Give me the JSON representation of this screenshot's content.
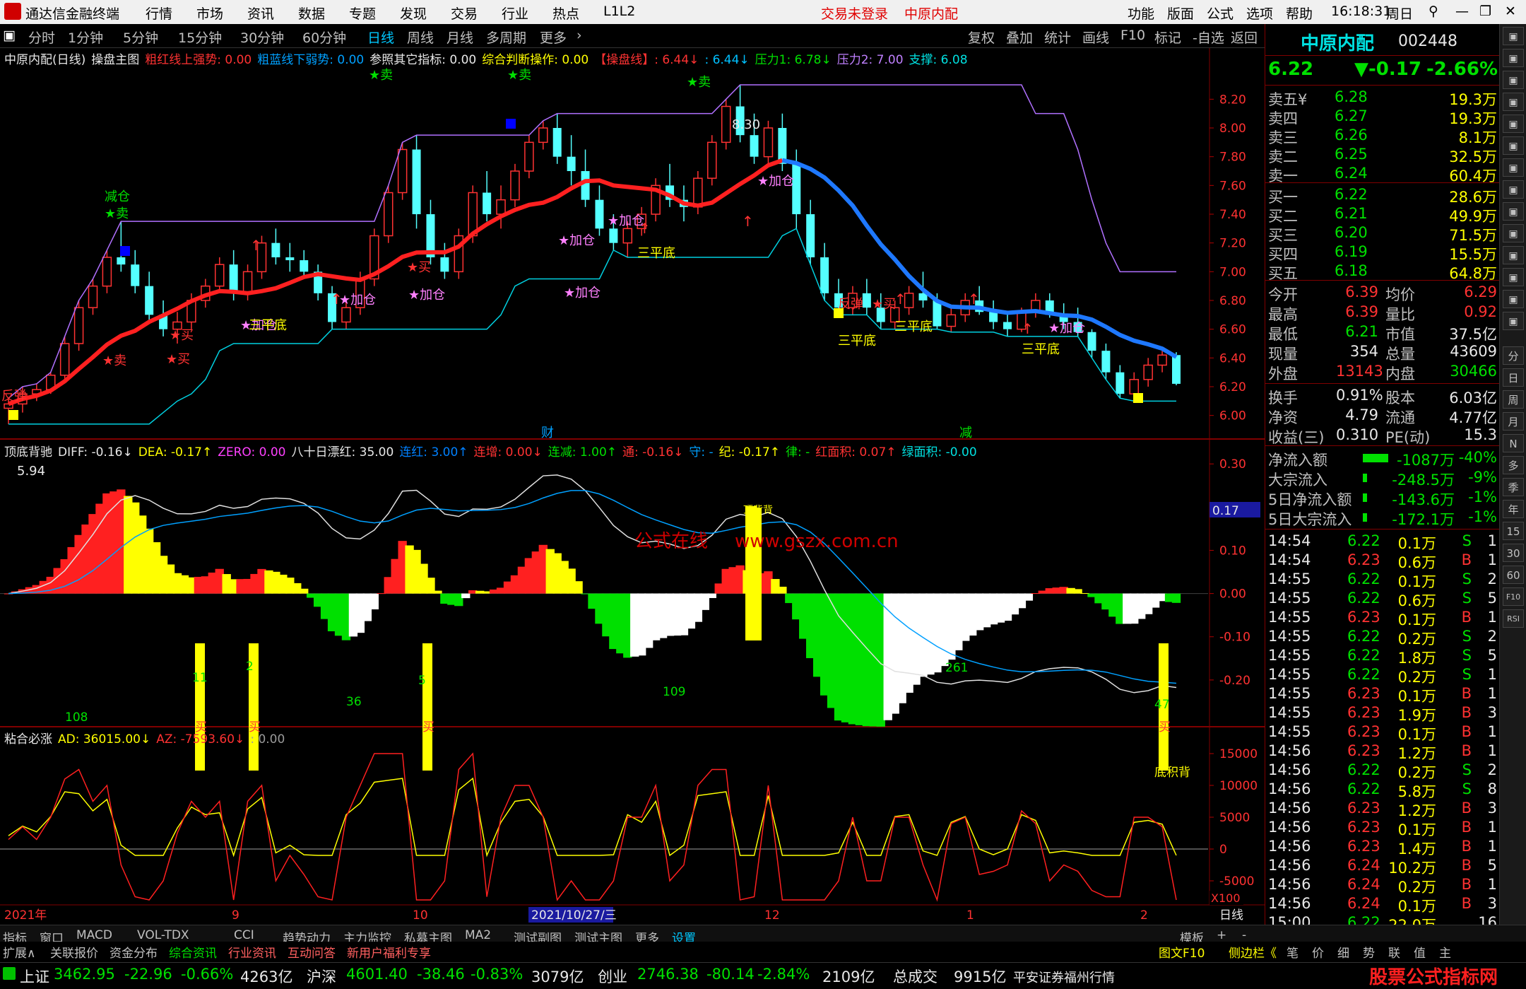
{
  "menubar": {
    "app_name": "通达信金融终端",
    "items": [
      "行情",
      "市场",
      "资讯",
      "数据",
      "专题",
      "发现",
      "交易",
      "行业",
      "热点",
      "L1L2"
    ],
    "login": "交易未登录",
    "stock": "中原内配",
    "right_items": [
      "功能",
      "版面",
      "公式",
      "选项",
      "帮助"
    ],
    "time": "16:18:31",
    "day": "周日"
  },
  "toolbar": {
    "periods": [
      "分时",
      "1分钟",
      "5分钟",
      "15分钟",
      "30分钟",
      "60分钟",
      "日线",
      "周线",
      "月线",
      "多周期",
      "更多"
    ],
    "active": "日线",
    "actions": [
      "复权",
      "叠加",
      "统计",
      "画线",
      "F10",
      "标记",
      "-自选",
      "返回"
    ]
  },
  "main_legend": {
    "title": "中原内配(日线)",
    "formula": "操盘主图",
    "items": [
      {
        "t": "粗红线上强势: 0.00",
        "c": "#ff3232"
      },
      {
        "t": "粗蓝线下弱势: 0.00",
        "c": "#00a0ff"
      },
      {
        "t": "参照其它指标: 0.00",
        "c": "#e8e8e8"
      },
      {
        "t": "综合判断操作: 0.00",
        "c": "#ffff00"
      },
      {
        "t": "【操盘线】: 6.44↓",
        "c": "#ff3232"
      },
      {
        "t": ": 6.44↓",
        "c": "#00c0ff"
      },
      {
        "t": "压力1: 6.78↓",
        "c": "#00e000"
      },
      {
        "t": "压力2: 7.00",
        "c": "#c080ff"
      },
      {
        "t": "支撑: 6.08",
        "c": "#00e0e0"
      }
    ]
  },
  "price_axis": [
    "8.20",
    "8.00",
    "7.80",
    "7.60",
    "7.40",
    "7.20",
    "7.00",
    "6.80",
    "6.60",
    "6.40",
    "6.20",
    "6.00"
  ],
  "main_annotations": {
    "high": "8.30",
    "low": "5.94",
    "labels": [
      "★卖",
      "★卖",
      "★卖",
      "★卖",
      "减仓",
      "★卖",
      "★买",
      "反弹",
      "★买",
      "★加仓",
      "★加仓",
      "★加仓",
      "★加仓",
      "★加仓",
      "★加仓",
      "★加仓",
      "★加仓",
      "三平底",
      "三平底",
      "三平底",
      "三平底",
      "三平底",
      "★买",
      "★买",
      "反弹"
    ],
    "event_cai": "财",
    "event_jian": "减"
  },
  "macd_legend": {
    "title": "顶底背驰",
    "items": [
      {
        "t": "DIFF: -0.16↓",
        "c": "#e8e8e8"
      },
      {
        "t": "DEA: -0.17↑",
        "c": "#ffff00"
      },
      {
        "t": "ZERO: 0.00",
        "c": "#ff40ff"
      },
      {
        "t": "八十日漂红: 35.00",
        "c": "#e8e8e8"
      },
      {
        "t": "连红: 3.00↑",
        "c": "#0080ff"
      },
      {
        "t": "连增: 0.00↓",
        "c": "#ff3232"
      },
      {
        "t": "连减: 1.00↑",
        "c": "#00e000"
      },
      {
        "t": "通: -0.16↓",
        "c": "#ff3232"
      },
      {
        "t": "守: -",
        "c": "#00a0ff"
      },
      {
        "t": "纪: -0.17↑",
        "c": "#ffff00"
      },
      {
        "t": "律: -",
        "c": "#00e000"
      },
      {
        "t": "红面积: 0.07↑",
        "c": "#ff3232"
      },
      {
        "t": "绿面积: -0.00",
        "c": "#00e0e0"
      }
    ]
  },
  "macd_axis": [
    "0.30",
    "0.20",
    "0.10",
    "0.00",
    "-0.10",
    "-0.20"
  ],
  "macd_current": "0.17",
  "watermark": {
    "cn": "公式在线",
    "url": "www.gszx.com.cn"
  },
  "macd_labels": {
    "counts": [
      "108",
      "36",
      "109",
      "261",
      "11",
      "2",
      "5",
      "47"
    ],
    "buy": "买",
    "sell_top": "顶背背",
    "bottom": "底积背"
  },
  "ad_legend": {
    "title": "粘合必涨",
    "items": [
      {
        "t": "AD: 36015.00↓",
        "c": "#ffff00"
      },
      {
        "t": "AZ: -7593.60↓",
        "c": "#ff3232"
      },
      {
        "t": ": 0.00",
        "c": "#9a9a9a"
      }
    ]
  },
  "ad_axis": [
    "15000",
    "10000",
    "5000",
    "0",
    "-5000"
  ],
  "ad_multiplier": "X100",
  "date_axis": {
    "labels": [
      "2021年",
      "9",
      "10",
      "11",
      "12",
      "1",
      "2"
    ],
    "cursor": "2021/10/27/三",
    "mode": "日线"
  },
  "chart_data": {
    "type": "candlestick",
    "ohlc": [
      [
        6.05,
        6.12,
        5.94,
        6.08
      ],
      [
        6.08,
        6.2,
        6.02,
        6.15
      ],
      [
        6.15,
        6.22,
        6.1,
        6.18
      ],
      [
        6.18,
        6.3,
        6.15,
        6.28
      ],
      [
        6.28,
        6.55,
        6.25,
        6.5
      ],
      [
        6.5,
        6.8,
        6.45,
        6.75
      ],
      [
        6.75,
        6.95,
        6.7,
        6.9
      ],
      [
        6.9,
        7.15,
        6.85,
        7.1
      ],
      [
        7.1,
        7.35,
        7.0,
        7.05
      ],
      [
        7.05,
        7.15,
        6.85,
        6.9
      ],
      [
        6.9,
        7.0,
        6.65,
        6.7
      ],
      [
        6.7,
        6.8,
        6.55,
        6.6
      ],
      [
        6.6,
        6.72,
        6.5,
        6.65
      ],
      [
        6.65,
        6.85,
        6.6,
        6.8
      ],
      [
        6.8,
        6.95,
        6.75,
        6.9
      ],
      [
        6.9,
        7.1,
        6.85,
        7.05
      ],
      [
        7.05,
        7.15,
        6.8,
        6.85
      ],
      [
        6.85,
        7.05,
        6.8,
        7.0
      ],
      [
        7.0,
        7.25,
        6.95,
        7.2
      ],
      [
        7.2,
        7.3,
        7.05,
        7.1
      ],
      [
        7.1,
        7.2,
        7.0,
        7.08
      ],
      [
        7.08,
        7.15,
        6.95,
        7.0
      ],
      [
        7.0,
        7.05,
        6.8,
        6.85
      ],
      [
        6.85,
        6.9,
        6.6,
        6.65
      ],
      [
        6.65,
        6.8,
        6.6,
        6.75
      ],
      [
        6.75,
        7.0,
        6.7,
        6.95
      ],
      [
        6.95,
        7.3,
        6.9,
        7.25
      ],
      [
        7.25,
        7.6,
        7.2,
        7.55
      ],
      [
        7.55,
        7.9,
        7.5,
        7.85
      ],
      [
        7.85,
        7.95,
        7.3,
        7.4
      ],
      [
        7.4,
        7.5,
        7.05,
        7.1
      ],
      [
        7.1,
        7.2,
        6.95,
        7.0
      ],
      [
        7.0,
        7.3,
        6.95,
        7.25
      ],
      [
        7.25,
        7.6,
        7.2,
        7.55
      ],
      [
        7.55,
        7.7,
        7.35,
        7.4
      ],
      [
        7.4,
        7.6,
        7.3,
        7.5
      ],
      [
        7.5,
        7.75,
        7.45,
        7.7
      ],
      [
        7.7,
        7.95,
        7.65,
        7.9
      ],
      [
        7.9,
        8.05,
        7.85,
        8.0
      ],
      [
        8.0,
        8.1,
        7.75,
        7.8
      ],
      [
        7.8,
        7.95,
        7.6,
        7.7
      ],
      [
        7.7,
        7.85,
        7.45,
        7.5
      ],
      [
        7.5,
        7.6,
        7.25,
        7.3
      ],
      [
        7.3,
        7.4,
        7.15,
        7.2
      ],
      [
        7.2,
        7.35,
        7.1,
        7.3
      ],
      [
        7.3,
        7.45,
        7.25,
        7.4
      ],
      [
        7.4,
        7.65,
        7.35,
        7.6
      ],
      [
        7.6,
        7.75,
        7.45,
        7.5
      ],
      [
        7.5,
        7.6,
        7.35,
        7.45
      ],
      [
        7.45,
        7.7,
        7.4,
        7.65
      ],
      [
        7.65,
        7.95,
        7.6,
        7.9
      ],
      [
        7.9,
        8.2,
        7.85,
        8.15
      ],
      [
        8.15,
        8.3,
        7.9,
        7.95
      ],
      [
        7.95,
        8.1,
        7.75,
        7.8
      ],
      [
        7.8,
        8.05,
        7.75,
        8.0
      ],
      [
        8.0,
        8.1,
        7.7,
        7.75
      ],
      [
        7.75,
        7.85,
        7.3,
        7.4
      ],
      [
        7.4,
        7.5,
        7.05,
        7.1
      ],
      [
        7.1,
        7.2,
        6.8,
        6.85
      ],
      [
        6.85,
        6.95,
        6.7,
        6.75
      ],
      [
        6.75,
        6.9,
        6.7,
        6.85
      ],
      [
        6.85,
        6.95,
        6.7,
        6.75
      ],
      [
        6.75,
        6.85,
        6.6,
        6.65
      ],
      [
        6.65,
        6.8,
        6.6,
        6.75
      ],
      [
        6.75,
        6.9,
        6.7,
        6.85
      ],
      [
        6.85,
        7.0,
        6.75,
        6.8
      ],
      [
        6.8,
        6.85,
        6.6,
        6.62
      ],
      [
        6.62,
        6.75,
        6.58,
        6.7
      ],
      [
        6.7,
        6.85,
        6.65,
        6.8
      ],
      [
        6.8,
        6.9,
        6.7,
        6.72
      ],
      [
        6.72,
        6.8,
        6.6,
        6.65
      ],
      [
        6.65,
        6.72,
        6.55,
        6.6
      ],
      [
        6.6,
        6.75,
        6.58,
        6.72
      ],
      [
        6.72,
        6.85,
        6.68,
        6.8
      ],
      [
        6.8,
        6.85,
        6.68,
        6.7
      ],
      [
        6.7,
        6.78,
        6.6,
        6.65
      ],
      [
        6.65,
        6.75,
        6.55,
        6.58
      ],
      [
        6.58,
        6.6,
        6.4,
        6.45
      ],
      [
        6.45,
        6.5,
        6.25,
        6.3
      ],
      [
        6.3,
        6.35,
        6.12,
        6.15
      ],
      [
        6.15,
        6.3,
        6.1,
        6.25
      ],
      [
        6.25,
        6.4,
        6.2,
        6.35
      ],
      [
        6.35,
        6.45,
        6.3,
        6.42
      ],
      [
        6.42,
        6.44,
        6.21,
        6.22
      ]
    ]
  },
  "quote": {
    "name": "中原内配",
    "code": "002448",
    "price": "6.22",
    "change": "▼-0.17",
    "pct": "-2.66%",
    "asks": [
      {
        "l": "卖五¥",
        "p": "6.28",
        "v": "19.3万"
      },
      {
        "l": "卖四",
        "p": "6.27",
        "v": "19.3万"
      },
      {
        "l": "卖三",
        "p": "6.26",
        "v": "8.1万"
      },
      {
        "l": "卖二",
        "p": "6.25",
        "v": "32.5万"
      },
      {
        "l": "卖一",
        "p": "6.24",
        "v": "60.4万"
      }
    ],
    "bids": [
      {
        "l": "买一",
        "p": "6.22",
        "v": "28.6万"
      },
      {
        "l": "买二",
        "p": "6.21",
        "v": "49.9万"
      },
      {
        "l": "买三",
        "p": "6.20",
        "v": "71.5万"
      },
      {
        "l": "买四",
        "p": "6.19",
        "v": "15.5万"
      },
      {
        "l": "买五",
        "p": "6.18",
        "v": "64.8万"
      }
    ],
    "stats": [
      {
        "a": "今开",
        "av": "6.39",
        "ac": "#ff3232",
        "b": "均价",
        "bv": "6.29",
        "bc": "#ff3232"
      },
      {
        "a": "最高",
        "av": "6.39",
        "ac": "#ff3232",
        "b": "量比",
        "bv": "0.92",
        "bc": "#ff3232"
      },
      {
        "a": "最低",
        "av": "6.21",
        "ac": "#00e000",
        "b": "市值",
        "bv": "37.5亿",
        "bc": "#e8e8e8"
      },
      {
        "a": "现量",
        "av": "354",
        "ac": "#e8e8e8",
        "b": "总量",
        "bv": "43609",
        "bc": "#e8e8e8"
      },
      {
        "a": "外盘",
        "av": "13143",
        "ac": "#ff3232",
        "b": "内盘",
        "bv": "30466",
        "bc": "#00e000"
      }
    ],
    "stats2": [
      {
        "a": "换手",
        "av": "0.91%",
        "b": "股本",
        "bv": "6.03亿"
      },
      {
        "a": "净资",
        "av": "4.79",
        "b": "流通",
        "bv": "4.77亿"
      },
      {
        "a": "收益(三)",
        "av": "0.310",
        "b": "PE(动)",
        "bv": "15.3"
      }
    ],
    "flows": [
      {
        "l": "净流入额",
        "v": "-1087万",
        "p": "-40%",
        "bar": 1.0
      },
      {
        "l": "大宗流入",
        "v": "-248.5万",
        "p": "-9%",
        "bar": 0.1
      },
      {
        "l": "5日净流入额",
        "v": "-143.6万",
        "p": "-1%",
        "bar": 0.05
      },
      {
        "l": "5日大宗流入",
        "v": "-172.1万",
        "p": "-1%",
        "bar": 0.05
      }
    ],
    "ticks": [
      [
        "14:54",
        "6.22",
        "0.1万",
        "S",
        "1"
      ],
      [
        "14:54",
        "6.23",
        "0.6万",
        "B",
        "1"
      ],
      [
        "14:55",
        "6.22",
        "0.1万",
        "S",
        "2"
      ],
      [
        "14:55",
        "6.22",
        "0.6万",
        "S",
        "5"
      ],
      [
        "14:55",
        "6.23",
        "0.1万",
        "B",
        "1"
      ],
      [
        "14:55",
        "6.22",
        "0.2万",
        "S",
        "2"
      ],
      [
        "14:55",
        "6.22",
        "1.8万",
        "S",
        "5"
      ],
      [
        "14:55",
        "6.22",
        "0.2万",
        "S",
        "1"
      ],
      [
        "14:55",
        "6.23",
        "0.1万",
        "B",
        "1"
      ],
      [
        "14:55",
        "6.23",
        "1.9万",
        "B",
        "3"
      ],
      [
        "14:55",
        "6.23",
        "0.1万",
        "B",
        "1"
      ],
      [
        "14:56",
        "6.23",
        "1.2万",
        "B",
        "1"
      ],
      [
        "14:56",
        "6.22",
        "0.2万",
        "S",
        "2"
      ],
      [
        "14:56",
        "6.22",
        "5.8万",
        "S",
        "8"
      ],
      [
        "14:56",
        "6.23",
        "1.2万",
        "B",
        "3"
      ],
      [
        "14:56",
        "6.23",
        "0.1万",
        "B",
        "1"
      ],
      [
        "14:56",
        "6.23",
        "1.4万",
        "B",
        "1"
      ],
      [
        "14:56",
        "6.24",
        "10.2万",
        "B",
        "5"
      ],
      [
        "14:56",
        "6.24",
        "0.2万",
        "B",
        "1"
      ],
      [
        "14:56",
        "6.24",
        "0.1万",
        "B",
        "3"
      ],
      [
        "15:00",
        "6.22",
        "22.0万",
        "",
        "16"
      ]
    ]
  },
  "vtool": [
    "分",
    "日",
    "周",
    "月",
    "N",
    "多",
    "季",
    "年",
    "15",
    "30",
    "60",
    "F10",
    "RSI"
  ],
  "tabs": [
    "指标",
    "窗口",
    "MACD",
    "VOL-TDX",
    "CCI",
    "趋势动力",
    "主力监控",
    "私募主图",
    "MA2",
    "测试副图",
    "测试主图",
    "更多",
    "设置"
  ],
  "tabs_right": [
    "模板",
    "+",
    "-"
  ],
  "tabs2": [
    "扩展∧",
    "关联报价",
    "资金分布",
    "综合资讯",
    "行业资讯",
    "互动问答",
    "新用户福利专享"
  ],
  "tabs2_right": [
    "图文F10",
    "侧边栏《",
    "笔",
    "价",
    "细",
    "势",
    "联",
    "值",
    "主"
  ],
  "status": {
    "sh_label": "上证",
    "sh": "3462.95",
    "sh_chg": "-22.96",
    "sh_pct": "-0.66%",
    "sh_amt": "4263亿",
    "sz_label": "沪深",
    "sz": "4601.40",
    "sz_chg": "-38.46",
    "sz_pct": "-0.83%",
    "sz_amt": "3079亿",
    "cy_label": "创业",
    "cy": "2746.38",
    "cy_chg": "-80.14",
    "cy_pct": "-2.84%",
    "cy_amt": "2109亿",
    "total_label": "总成交",
    "total": "9915亿",
    "broker": "平安证券福州行情",
    "brand": "股票公式指标网",
    "brand_url": "www.gszx.com.cn"
  }
}
